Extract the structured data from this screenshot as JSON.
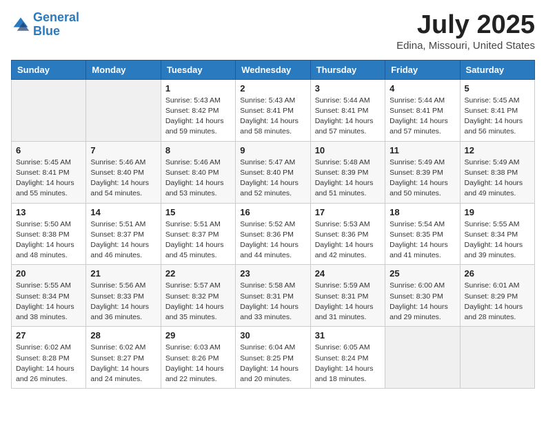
{
  "logo": {
    "line1": "General",
    "line2": "Blue"
  },
  "title": "July 2025",
  "location": "Edina, Missouri, United States",
  "days_header": [
    "Sunday",
    "Monday",
    "Tuesday",
    "Wednesday",
    "Thursday",
    "Friday",
    "Saturday"
  ],
  "weeks": [
    [
      {
        "day": "",
        "sunrise": "",
        "sunset": "",
        "daylight": ""
      },
      {
        "day": "",
        "sunrise": "",
        "sunset": "",
        "daylight": ""
      },
      {
        "day": "1",
        "sunrise": "Sunrise: 5:43 AM",
        "sunset": "Sunset: 8:42 PM",
        "daylight": "Daylight: 14 hours and 59 minutes."
      },
      {
        "day": "2",
        "sunrise": "Sunrise: 5:43 AM",
        "sunset": "Sunset: 8:41 PM",
        "daylight": "Daylight: 14 hours and 58 minutes."
      },
      {
        "day": "3",
        "sunrise": "Sunrise: 5:44 AM",
        "sunset": "Sunset: 8:41 PM",
        "daylight": "Daylight: 14 hours and 57 minutes."
      },
      {
        "day": "4",
        "sunrise": "Sunrise: 5:44 AM",
        "sunset": "Sunset: 8:41 PM",
        "daylight": "Daylight: 14 hours and 57 minutes."
      },
      {
        "day": "5",
        "sunrise": "Sunrise: 5:45 AM",
        "sunset": "Sunset: 8:41 PM",
        "daylight": "Daylight: 14 hours and 56 minutes."
      }
    ],
    [
      {
        "day": "6",
        "sunrise": "Sunrise: 5:45 AM",
        "sunset": "Sunset: 8:41 PM",
        "daylight": "Daylight: 14 hours and 55 minutes."
      },
      {
        "day": "7",
        "sunrise": "Sunrise: 5:46 AM",
        "sunset": "Sunset: 8:40 PM",
        "daylight": "Daylight: 14 hours and 54 minutes."
      },
      {
        "day": "8",
        "sunrise": "Sunrise: 5:46 AM",
        "sunset": "Sunset: 8:40 PM",
        "daylight": "Daylight: 14 hours and 53 minutes."
      },
      {
        "day": "9",
        "sunrise": "Sunrise: 5:47 AM",
        "sunset": "Sunset: 8:40 PM",
        "daylight": "Daylight: 14 hours and 52 minutes."
      },
      {
        "day": "10",
        "sunrise": "Sunrise: 5:48 AM",
        "sunset": "Sunset: 8:39 PM",
        "daylight": "Daylight: 14 hours and 51 minutes."
      },
      {
        "day": "11",
        "sunrise": "Sunrise: 5:49 AM",
        "sunset": "Sunset: 8:39 PM",
        "daylight": "Daylight: 14 hours and 50 minutes."
      },
      {
        "day": "12",
        "sunrise": "Sunrise: 5:49 AM",
        "sunset": "Sunset: 8:38 PM",
        "daylight": "Daylight: 14 hours and 49 minutes."
      }
    ],
    [
      {
        "day": "13",
        "sunrise": "Sunrise: 5:50 AM",
        "sunset": "Sunset: 8:38 PM",
        "daylight": "Daylight: 14 hours and 48 minutes."
      },
      {
        "day": "14",
        "sunrise": "Sunrise: 5:51 AM",
        "sunset": "Sunset: 8:37 PM",
        "daylight": "Daylight: 14 hours and 46 minutes."
      },
      {
        "day": "15",
        "sunrise": "Sunrise: 5:51 AM",
        "sunset": "Sunset: 8:37 PM",
        "daylight": "Daylight: 14 hours and 45 minutes."
      },
      {
        "day": "16",
        "sunrise": "Sunrise: 5:52 AM",
        "sunset": "Sunset: 8:36 PM",
        "daylight": "Daylight: 14 hours and 44 minutes."
      },
      {
        "day": "17",
        "sunrise": "Sunrise: 5:53 AM",
        "sunset": "Sunset: 8:36 PM",
        "daylight": "Daylight: 14 hours and 42 minutes."
      },
      {
        "day": "18",
        "sunrise": "Sunrise: 5:54 AM",
        "sunset": "Sunset: 8:35 PM",
        "daylight": "Daylight: 14 hours and 41 minutes."
      },
      {
        "day": "19",
        "sunrise": "Sunrise: 5:55 AM",
        "sunset": "Sunset: 8:34 PM",
        "daylight": "Daylight: 14 hours and 39 minutes."
      }
    ],
    [
      {
        "day": "20",
        "sunrise": "Sunrise: 5:55 AM",
        "sunset": "Sunset: 8:34 PM",
        "daylight": "Daylight: 14 hours and 38 minutes."
      },
      {
        "day": "21",
        "sunrise": "Sunrise: 5:56 AM",
        "sunset": "Sunset: 8:33 PM",
        "daylight": "Daylight: 14 hours and 36 minutes."
      },
      {
        "day": "22",
        "sunrise": "Sunrise: 5:57 AM",
        "sunset": "Sunset: 8:32 PM",
        "daylight": "Daylight: 14 hours and 35 minutes."
      },
      {
        "day": "23",
        "sunrise": "Sunrise: 5:58 AM",
        "sunset": "Sunset: 8:31 PM",
        "daylight": "Daylight: 14 hours and 33 minutes."
      },
      {
        "day": "24",
        "sunrise": "Sunrise: 5:59 AM",
        "sunset": "Sunset: 8:31 PM",
        "daylight": "Daylight: 14 hours and 31 minutes."
      },
      {
        "day": "25",
        "sunrise": "Sunrise: 6:00 AM",
        "sunset": "Sunset: 8:30 PM",
        "daylight": "Daylight: 14 hours and 29 minutes."
      },
      {
        "day": "26",
        "sunrise": "Sunrise: 6:01 AM",
        "sunset": "Sunset: 8:29 PM",
        "daylight": "Daylight: 14 hours and 28 minutes."
      }
    ],
    [
      {
        "day": "27",
        "sunrise": "Sunrise: 6:02 AM",
        "sunset": "Sunset: 8:28 PM",
        "daylight": "Daylight: 14 hours and 26 minutes."
      },
      {
        "day": "28",
        "sunrise": "Sunrise: 6:02 AM",
        "sunset": "Sunset: 8:27 PM",
        "daylight": "Daylight: 14 hours and 24 minutes."
      },
      {
        "day": "29",
        "sunrise": "Sunrise: 6:03 AM",
        "sunset": "Sunset: 8:26 PM",
        "daylight": "Daylight: 14 hours and 22 minutes."
      },
      {
        "day": "30",
        "sunrise": "Sunrise: 6:04 AM",
        "sunset": "Sunset: 8:25 PM",
        "daylight": "Daylight: 14 hours and 20 minutes."
      },
      {
        "day": "31",
        "sunrise": "Sunrise: 6:05 AM",
        "sunset": "Sunset: 8:24 PM",
        "daylight": "Daylight: 14 hours and 18 minutes."
      },
      {
        "day": "",
        "sunrise": "",
        "sunset": "",
        "daylight": ""
      },
      {
        "day": "",
        "sunrise": "",
        "sunset": "",
        "daylight": ""
      }
    ]
  ]
}
